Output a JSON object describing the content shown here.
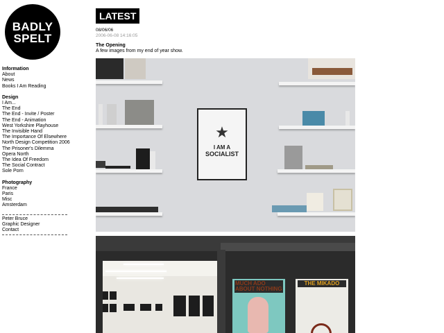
{
  "logo": {
    "line1": "BADLY",
    "line2": "SPELT"
  },
  "sidebar": {
    "information": {
      "heading": "Information",
      "items": [
        "About",
        "News",
        "Books I Am Reading"
      ]
    },
    "design": {
      "heading": "Design",
      "items": [
        "I Am...",
        "The End",
        "The End - Invite / Poster",
        "The End - Animation",
        "West Yorkshire Playhouse",
        "The Invisible Hand",
        "The Importance Of Elsewhere",
        "North Design Competition 2006",
        "The Prisoner's Dilemma",
        "Opera North",
        "The Idea Of Freedom",
        "The Social Contract",
        "Sole Porn"
      ]
    },
    "photography": {
      "heading": "Photography",
      "items": [
        "France",
        "Paris",
        "Misc",
        "Amsterdam"
      ]
    },
    "footer_items": [
      "Peter Bruce",
      "Graphic Designer",
      "Contact"
    ]
  },
  "main": {
    "badge": "LATEST",
    "date": "08/06/06",
    "datetime": "2006-06-08 14:16:05",
    "post_title": "The Opening",
    "post_desc": "A few images from my end of year show.",
    "photo1": {
      "poster_line1": "I AM A",
      "poster_line2": "SOCIALIST"
    },
    "photo2": {
      "poster_a": "MUCH ADO ABOUT NOTHING",
      "poster_b": "THE MIKADO"
    }
  }
}
